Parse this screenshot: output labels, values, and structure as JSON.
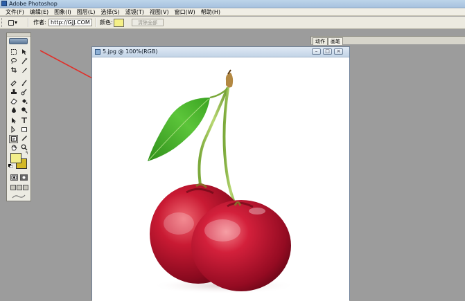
{
  "app": {
    "title": "Adobe Photoshop"
  },
  "menu": [
    "文件(F)",
    "编辑(E)",
    "图象(I)",
    "图层(L)",
    "选择(S)",
    "滤镜(T)",
    "视图(V)",
    "窗口(W)",
    "帮助(H)"
  ],
  "options": {
    "tool_preset": "▾",
    "author_label": "作者:",
    "author_value": "http://GJJ.COM",
    "color_label": "颜色:",
    "color_value": "#f5f087",
    "clear_button": "清除全部"
  },
  "dock": {
    "tabs": [
      "动作",
      "画笔"
    ]
  },
  "toolbox": {
    "foreground_color": "#f2ee8a",
    "background_color": "#d3b827"
  },
  "document": {
    "title": "5.jpg @ 100%(RGB)",
    "buttons": [
      "minimize-icon",
      "maximize-icon",
      "close-icon"
    ]
  },
  "colors": {
    "arrow": "#e0302a",
    "cherry": "#b3122a",
    "leaf": "#3aa321"
  }
}
